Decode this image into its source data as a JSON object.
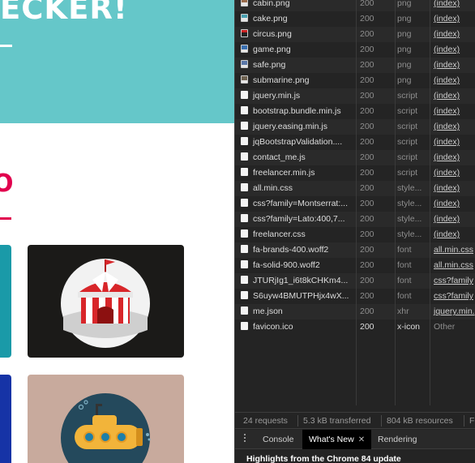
{
  "site": {
    "hero_title": "ECKER!",
    "section_letter": "O"
  },
  "network": {
    "rows": [
      {
        "name": "cabin.png",
        "status": "200",
        "type": "png",
        "initiator": "(index)",
        "icon": "image-file-icon"
      },
      {
        "name": "cake.png",
        "status": "200",
        "type": "png",
        "initiator": "(index)",
        "icon": "image-file-icon"
      },
      {
        "name": "circus.png",
        "status": "200",
        "type": "png",
        "initiator": "(index)",
        "icon": "image-file-icon"
      },
      {
        "name": "game.png",
        "status": "200",
        "type": "png",
        "initiator": "(index)",
        "icon": "image-file-icon"
      },
      {
        "name": "safe.png",
        "status": "200",
        "type": "png",
        "initiator": "(index)",
        "icon": "image-file-icon"
      },
      {
        "name": "submarine.png",
        "status": "200",
        "type": "png",
        "initiator": "(index)",
        "icon": "image-file-icon"
      },
      {
        "name": "jquery.min.js",
        "status": "200",
        "type": "script",
        "initiator": "(index)",
        "icon": "file-icon"
      },
      {
        "name": "bootstrap.bundle.min.js",
        "status": "200",
        "type": "script",
        "initiator": "(index)",
        "icon": "file-icon"
      },
      {
        "name": "jquery.easing.min.js",
        "status": "200",
        "type": "script",
        "initiator": "(index)",
        "icon": "file-icon"
      },
      {
        "name": "jqBootstrapValidation....",
        "status": "200",
        "type": "script",
        "initiator": "(index)",
        "icon": "file-icon"
      },
      {
        "name": "contact_me.js",
        "status": "200",
        "type": "script",
        "initiator": "(index)",
        "icon": "file-icon"
      },
      {
        "name": "freelancer.min.js",
        "status": "200",
        "type": "script",
        "initiator": "(index)",
        "icon": "file-icon"
      },
      {
        "name": "all.min.css",
        "status": "200",
        "type": "style...",
        "initiator": "(index)",
        "icon": "file-icon"
      },
      {
        "name": "css?family=Montserrat:...",
        "status": "200",
        "type": "style...",
        "initiator": "(index)",
        "icon": "file-icon"
      },
      {
        "name": "css?family=Lato:400,7...",
        "status": "200",
        "type": "style...",
        "initiator": "(index)",
        "icon": "file-icon"
      },
      {
        "name": "freelancer.css",
        "status": "200",
        "type": "style...",
        "initiator": "(index)",
        "icon": "file-icon"
      },
      {
        "name": "fa-brands-400.woff2",
        "status": "200",
        "type": "font",
        "initiator": "all.min.css",
        "icon": "file-icon"
      },
      {
        "name": "fa-solid-900.woff2",
        "status": "200",
        "type": "font",
        "initiator": "all.min.css",
        "icon": "file-icon"
      },
      {
        "name": "JTURjIg1_i6t8kCHKm4...",
        "status": "200",
        "type": "font",
        "initiator": "css?family",
        "icon": "file-icon"
      },
      {
        "name": "S6uyw4BMUTPHjx4wX...",
        "status": "200",
        "type": "font",
        "initiator": "css?family",
        "icon": "file-icon"
      },
      {
        "name": "me.json",
        "status": "200",
        "type": "xhr",
        "initiator": "jquery.min.",
        "icon": "file-icon"
      },
      {
        "name": "favicon.ico",
        "status": "200",
        "type": "x-icon",
        "initiator": "Other",
        "icon": "file-icon"
      }
    ]
  },
  "summary": {
    "requests": "24 requests",
    "transferred": "5.3 kB transferred",
    "resources": "804 kB resources",
    "finish": "Fi"
  },
  "drawer": {
    "tabs": [
      {
        "label": "Console"
      },
      {
        "label": "What's New"
      },
      {
        "label": "Rendering"
      }
    ],
    "close_glyph": "✕",
    "highlights": "Highlights from the Chrome 84 update"
  },
  "colors": {
    "hero": "#65c7c9",
    "accent": "#e1004e",
    "devtools_bg": "#242424"
  }
}
